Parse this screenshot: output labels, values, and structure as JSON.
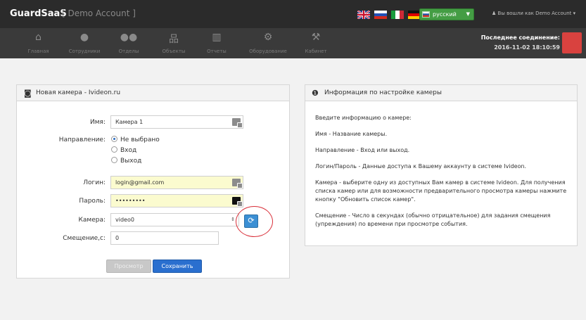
{
  "header": {
    "brand": "GuardSaaS",
    "account": "[ Demo Account ]",
    "language": "русский",
    "user": "Вы вошли как Demo Account"
  },
  "flags": [
    {
      "name": "uk-flag-icon"
    },
    {
      "name": "ru-flag-icon"
    },
    {
      "name": "it-flag-icon"
    },
    {
      "name": "de-flag-icon"
    }
  ],
  "nav": {
    "items": [
      {
        "label": "Главная",
        "icon": "home-icon"
      },
      {
        "label": "Сотрудники",
        "icon": "user-icon"
      },
      {
        "label": "Отделы",
        "icon": "group-icon"
      },
      {
        "label": "Объекты",
        "icon": "sitemap-icon"
      },
      {
        "label": "Отчеты",
        "icon": "chart-icon"
      },
      {
        "label": "Оборудование",
        "icon": "gears-icon"
      },
      {
        "label": "Кабинет",
        "icon": "wrench-icon"
      }
    ],
    "connection_label": "Последнее соединение:",
    "connection_time": "2016-11-02 18:10:59"
  },
  "form": {
    "title": "Новая камера - Ivideon.ru",
    "name_label": "Имя:",
    "name_value": "Камера 1",
    "direction_label": "Направление:",
    "direction_options": [
      "Не выбрано",
      "Вход",
      "Выход"
    ],
    "login_label": "Логин:",
    "login_value": "login@gmail.com",
    "password_label": "Пароль:",
    "password_value": "•••••••••",
    "camera_label": "Камера:",
    "camera_value": "video0",
    "offset_label": "Смещение,с:",
    "offset_value": "0",
    "preview_button": "Просмотр",
    "save_button": "Сохранить"
  },
  "info": {
    "title": "Информация по настройке камеры",
    "lines": [
      "Введите информацию о камере:",
      "Имя - Название камеры.",
      "Направление - Вход или выход.",
      "Логин/Пароль - Данные доступа к Вашему аккаунту в системе Ivideon.",
      "Камера - выберите одну из доступных Вам камер в системе Ivideon. Для получения списка камер или для возможности предварительного просмотра камеры нажмите кнопку \"Обновить список камер\".",
      "Смещение - Число в секундах (обычно отрицательное) для задания смещения (упреждения) по времени при просмотре события."
    ]
  },
  "colors": {
    "topbar": "#2b2b2b",
    "navbar": "#3a3a3a",
    "accent_blue": "#2a6fcf",
    "lang_green": "#449d44",
    "status_red": "#d9423f",
    "highlight_circle": "#d9303a"
  }
}
